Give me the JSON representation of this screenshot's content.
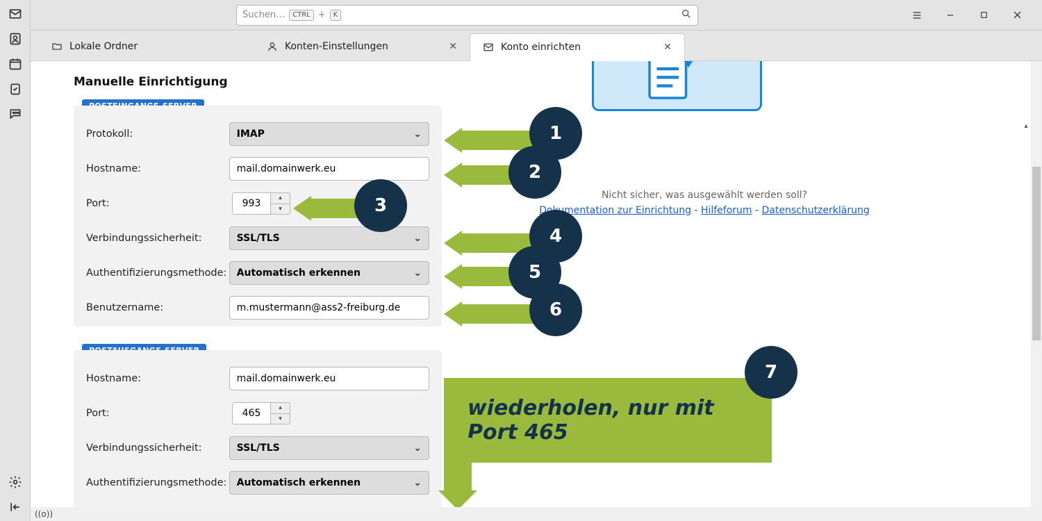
{
  "titlebar": {
    "search_placeholder": "Suchen…",
    "kbd1": "CTRL",
    "kbd_plus": "+",
    "kbd2": "K"
  },
  "tabs": {
    "t0": "Lokale Ordner",
    "t1": "Konten-Einstellungen",
    "t2": "Konto einrichten"
  },
  "heading": "Manuelle Einrichtigung",
  "in_badge": "POSTEINGANGS-SERVER",
  "out_badge": "POSTAUSGANGS-SERVER",
  "labels": {
    "protocol": "Protokoll:",
    "hostname": "Hostname:",
    "port": "Port:",
    "sec": "Verbindungssicherheit:",
    "auth": "Authentifizierungsmethode:",
    "user": "Benutzername:"
  },
  "in": {
    "protocol": "IMAP",
    "hostname": "mail.domainwerk.eu",
    "port": "993",
    "sec": "SSL/TLS",
    "auth": "Automatisch erkennen",
    "user": "m.mustermann@ass2-freiburg.de"
  },
  "out": {
    "hostname": "mail.domainwerk.eu",
    "port": "465",
    "sec": "SSL/TLS",
    "auth": "Automatisch erkennen"
  },
  "help": {
    "q": "Nicht sicher, was ausgewählt werden soll?",
    "l1": "Dokumentation zur Einrichtung",
    "l2": "Hilfeforum",
    "l3": "Datenschutzerklärung",
    "sep": " - "
  },
  "anno": {
    "n1": "1",
    "n2": "2",
    "n3": "3",
    "n4": "4",
    "n5": "5",
    "n6": "6",
    "n7": "7",
    "banner": "wiederholen, nur mit Port 465"
  },
  "status": "((o))"
}
